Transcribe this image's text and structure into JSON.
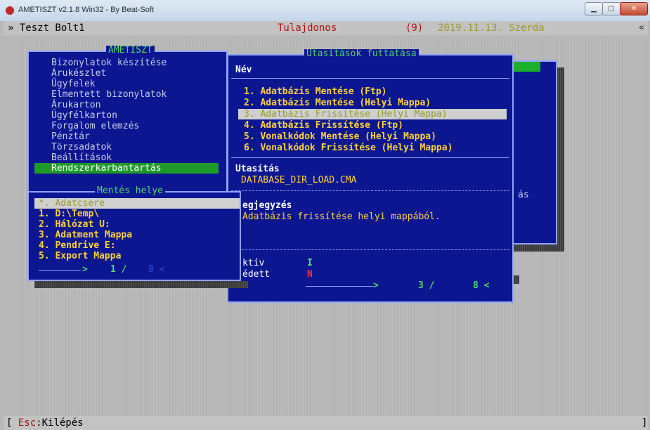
{
  "window": {
    "title": "AMETISZT v2.1.8 Win32  -  By Beat-Soft",
    "min_label": "▁",
    "max_label": "▢",
    "close_label": "✕"
  },
  "topbar": {
    "shop": "» Teszt Bolt1",
    "owner": "Tulajdonos",
    "count": "(9)",
    "date": "2019.11.13. Szerda",
    "right_arrow": "«"
  },
  "main_menu": {
    "title": "AMETISZT",
    "items": [
      "Bizonylatok készítése",
      "Árukészlet",
      "Ügyfelek",
      "Elmentett bizonylatok",
      "Árukarton",
      "Ügyfélkarton",
      "Forgalom elemzés",
      "Pénztár",
      "Törzsadatok",
      "Beállítások",
      "Rendszerkarbantartás"
    ],
    "selected_index": 10
  },
  "task_panel": {
    "title": "Utasítások futtatása",
    "name_header": "Név",
    "tasks": [
      "1. Adatbázis Mentése (Ftp)",
      "2. Adatbázis Mentése (Helyi Mappa)",
      "3. Adatbázis Frissítése (Helyi Mappa)",
      "4. Adatbázis Frissítése (Ftp)",
      "5. Vonalkódok Mentése (Helyi Mappa)",
      "6. Vonalkódok Frissítése (Helyi Mappa)"
    ],
    "selected_index": 2,
    "command_label": "Utasítás",
    "command_value": "DATABASE_DIR_LOAD.CMA",
    "note_label": "egjegyzés",
    "note_value": "Adatbázis frissítése helyi mappából.",
    "active_label": "ktív",
    "active_value": "I",
    "protected_label": "édett",
    "protected_value": "N",
    "pager_arrow_right": ">",
    "pager_page": "3 /",
    "pager_total": "8 <"
  },
  "save_panel": {
    "title": "Mentés helye",
    "items": [
      "*. Adatcsere",
      "1. D:\\Temp\\",
      "2. Hálózat U:",
      "3. Adatment Mappa",
      "4. Pendrive E:",
      "5. Export Mappa"
    ],
    "selected_index": 0,
    "pager_arrow_right": ">",
    "pager_page": "1 /",
    "pager_total": "8 <"
  },
  "behind": {
    "text": "ás"
  },
  "bottombar": {
    "open": "[ ",
    "key": "Esc",
    "action": ":Kilépés",
    "close": "]"
  },
  "colors": {
    "panel_bg": "#0c1690",
    "border": "#8fa3ff",
    "title_green": "#56d66a",
    "item_yellow": "#ffd23a",
    "menu_text": "#c9cde6",
    "menu_highlight": "#1d9a2a",
    "selection_grey": "#cfcfcf",
    "owner_red": "#b01010",
    "date_olive": "#9a9a2a"
  }
}
